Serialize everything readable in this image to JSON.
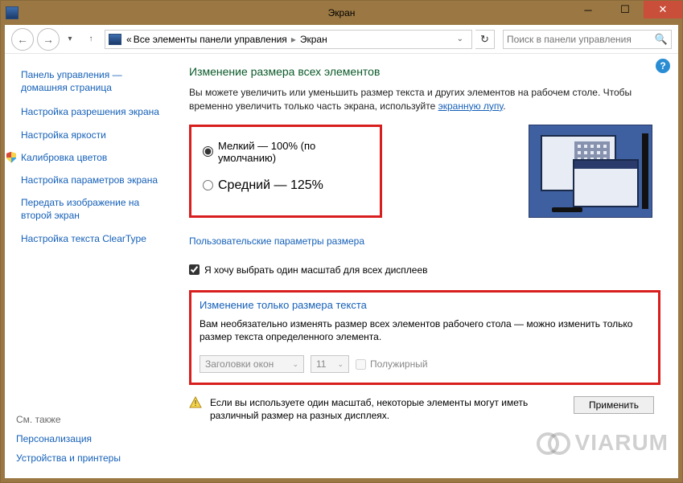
{
  "titlebar": {
    "title": "Экран"
  },
  "nav": {
    "breadcrumb_prefix": "«",
    "breadcrumb_parent": "Все элементы панели управления",
    "breadcrumb_current": "Экран",
    "search_placeholder": "Поиск в панели управления"
  },
  "sidebar": {
    "home": "Панель управления — домашняя страница",
    "items": [
      "Настройка разрешения экрана",
      "Настройка яркости",
      "Калибровка цветов",
      "Настройка параметров экрана",
      "Передать изображение на второй экран",
      "Настройка текста ClearType"
    ],
    "see_also_heading": "См. также",
    "see_also": [
      "Персонализация",
      "Устройства и принтеры"
    ]
  },
  "main": {
    "heading": "Изменение размера всех элементов",
    "desc_before": "Вы можете увеличить или уменьшить размер текста и других элементов на рабочем столе. Чтобы временно увеличить только часть экрана, используйте ",
    "desc_link": "экранную лупу",
    "desc_after": ".",
    "scale": {
      "small": "Мелкий — 100% (по умолчанию)",
      "medium": "Средний — 125%"
    },
    "custom_link": "Пользовательские параметры размера",
    "one_scale_checkbox": "Я хочу выбрать один масштаб для всех дисплеев",
    "textsize": {
      "heading": "Изменение только размера текста",
      "desc": "Вам необязательно изменять размер всех элементов рабочего стола — можно изменить только размер текста определенного элемента.",
      "select_item": "Заголовки окон",
      "select_size": "11",
      "bold_label": "Полужирный"
    },
    "footer_warning": "Если вы используете один масштаб, некоторые элементы могут иметь различный размер на разных дисплеях.",
    "apply_button": "Применить"
  },
  "watermark": "VIARUM"
}
